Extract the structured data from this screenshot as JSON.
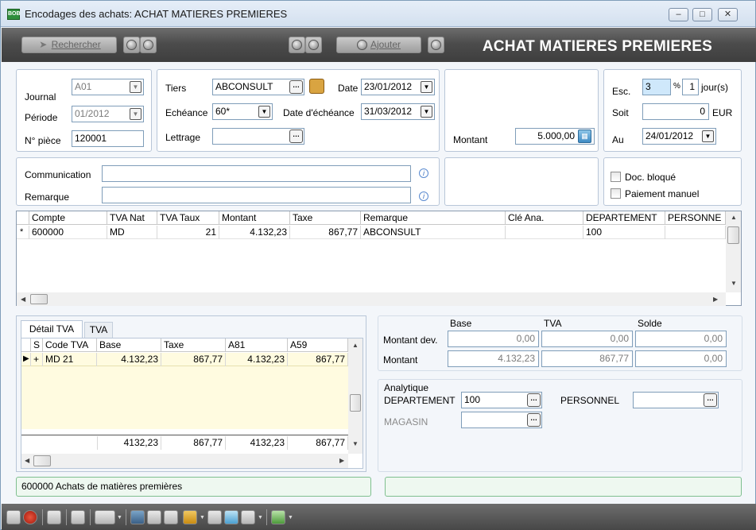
{
  "window": {
    "title": "Encodages des achats:  ACHAT MATIERES PREMIERES",
    "app_icon_text": "BOB"
  },
  "toolbar": {
    "search_label": "Rechercher",
    "add_label": "Ajouter",
    "header_title": "ACHAT MATIERES PREMIERES"
  },
  "header_form": {
    "journal_label": "Journal",
    "journal_value": "A01",
    "periode_label": "Période",
    "periode_value": "01/2012",
    "piece_label": "N° pièce",
    "piece_value": "120001",
    "tiers_label": "Tiers",
    "tiers_value": "ABCONSULT",
    "echeance_label": "Echéance",
    "echeance_value": "60*",
    "lettrage_label": "Lettrage",
    "lettrage_value": "",
    "date_label": "Date",
    "date_value": "23/01/2012",
    "date_echeance_label": "Date d'échéance",
    "date_echeance_value": "31/03/2012",
    "montant_label": "Montant",
    "montant_value": "5.000,00",
    "esc_label": "Esc.",
    "esc_value": "3",
    "esc_pct": "%",
    "days_value": "1",
    "days_label": "jour(s)",
    "soit_label": "Soit",
    "soit_value": "0",
    "soit_currency": "EUR",
    "au_label": "Au",
    "au_value": "24/01/2012"
  },
  "comm_form": {
    "communication_label": "Communication",
    "communication_value": "",
    "remarque_label": "Remarque",
    "remarque_value": "",
    "doc_bloque_label": "Doc. bloqué",
    "paiement_manuel_label": "Paiement manuel"
  },
  "main_grid": {
    "columns": [
      "Compte",
      "TVA Nat",
      "TVA Taux",
      "Montant",
      "Taxe",
      "Remarque",
      "Clé Ana.",
      "DEPARTEMENT",
      "PERSONNE"
    ],
    "row_marker": "*",
    "rows": [
      [
        "600000",
        "MD",
        "21",
        "4.132,23",
        "867,77",
        "ABCONSULT",
        "",
        "100",
        ""
      ]
    ]
  },
  "tabs": [
    "Détail TVA",
    "TVA"
  ],
  "vat_grid": {
    "columns": [
      "S",
      "Code TVA",
      "Base",
      "Taxe",
      "A81",
      "A59"
    ],
    "row_marker": "▶",
    "rows": [
      [
        "+",
        "MD 21",
        "4.132,23",
        "867,77",
        "4.132,23",
        "867,77"
      ]
    ],
    "totals": [
      "4132,23",
      "867,77",
      "4132,23",
      "867,77"
    ]
  },
  "totals_panel": {
    "col_base": "Base",
    "col_tva": "TVA",
    "col_solde": "Solde",
    "row1_label": "Montant dev.",
    "row1_values": [
      "0,00",
      "0,00",
      "0,00"
    ],
    "row2_label": "Montant",
    "row2_values": [
      "4.132,23",
      "867,77",
      "0,00"
    ]
  },
  "analytique": {
    "title": "Analytique",
    "departement_label": "DEPARTEMENT",
    "departement_value": "100",
    "personnel_label": "PERSONNEL",
    "personnel_value": "",
    "magasin_label": "MAGASIN",
    "magasin_value": ""
  },
  "status": {
    "left": "600000  Achats de matières premières",
    "right": ""
  },
  "colors": {
    "toolbar": "#4c4c4c",
    "status_bg": "#eef8f0",
    "grid_selected_row": "#fffbe0",
    "accent_blue": "#cfe8fb"
  }
}
